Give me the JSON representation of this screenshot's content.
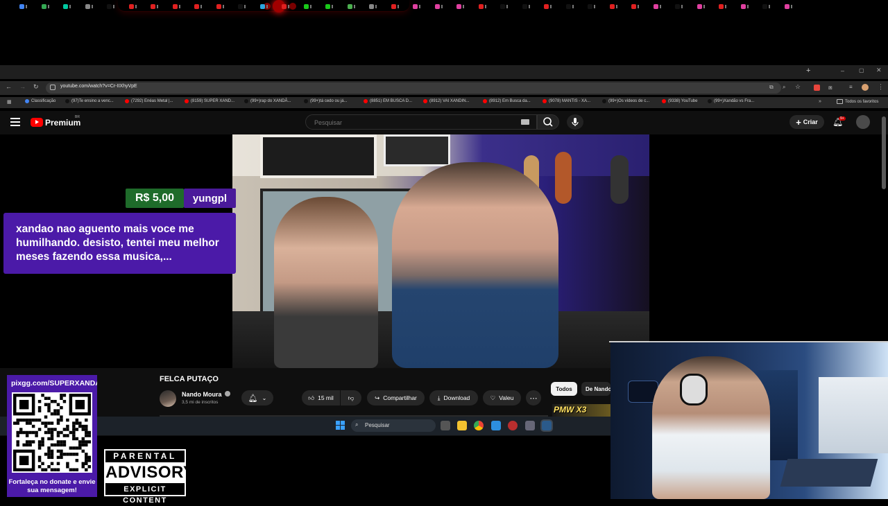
{
  "browser": {
    "url": "youtube.com/watch?v=Cr-IIXhyVpE",
    "bookmarks": [
      {
        "label": "Classificação",
        "color": "#4285f4"
      },
      {
        "label": "(97)Te ensino a venc...",
        "color": "#111111"
      },
      {
        "label": "(7292) Enéas Metal |...",
        "color": "#ff0000"
      },
      {
        "label": "(8159) SUPER XAND...",
        "color": "#ff0000"
      },
      {
        "label": "(99+)rap do XANDÃ...",
        "color": "#111111"
      },
      {
        "label": "(99+)tá cedo ou já...",
        "color": "#111111"
      },
      {
        "label": "(8851) EM BUSCA D...",
        "color": "#ff0000"
      },
      {
        "label": "(8912) VAI XANDIN...",
        "color": "#ff0000"
      },
      {
        "label": "(8912) Em Busca da...",
        "color": "#ff0000"
      },
      {
        "label": "(9078) MANTIS - XA...",
        "color": "#ff0000"
      },
      {
        "label": "(99+)Os vídeos de c...",
        "color": "#111111"
      },
      {
        "label": "(9338) YouTube",
        "color": "#ff0000"
      },
      {
        "label": "(99+)Xandão vs Fra...",
        "color": "#111111"
      }
    ],
    "all_favorites": "Todos os favoritos"
  },
  "youtube": {
    "brand": "Premium",
    "country": "BR",
    "search_placeholder": "Pesquisar",
    "create_label": "Criar",
    "notifications": "9+",
    "video_title": "FELCA PUTAÇO",
    "channel_name": "Nando Moura",
    "subscribers": "3,5 mi de inscritos",
    "likes": "15 mil",
    "share_label": "Compartilhar",
    "download_label": "Download",
    "thanks_label": "Valeu",
    "chips": [
      "Todos",
      "De Nando"
    ],
    "thumb_text": "PMW X3"
  },
  "superchat": {
    "amount": "R$ 5,00",
    "name": "yungpl",
    "message": "xandao nao aguento mais voce me humilhando. desisto, tentei meu melhor meses fazendo essa musica,..."
  },
  "taskbar": {
    "search_placeholder": "Pesquisar"
  },
  "overlay": {
    "pix_url": "pixgg.com/SUPERXANDAO",
    "pix_caption": "Fortaleça no donate e envie sua mensagem!",
    "advisory_top": "PARENTAL",
    "advisory_mid": "ADVISORY",
    "advisory_bottom": "EXPLICIT CONTENT"
  },
  "colors": {
    "youtube_red": "#ff0000",
    "superchat_green": "#1e6b2a",
    "superchat_purple": "#4b1aa8",
    "chip_active": "#f1f1f1"
  }
}
